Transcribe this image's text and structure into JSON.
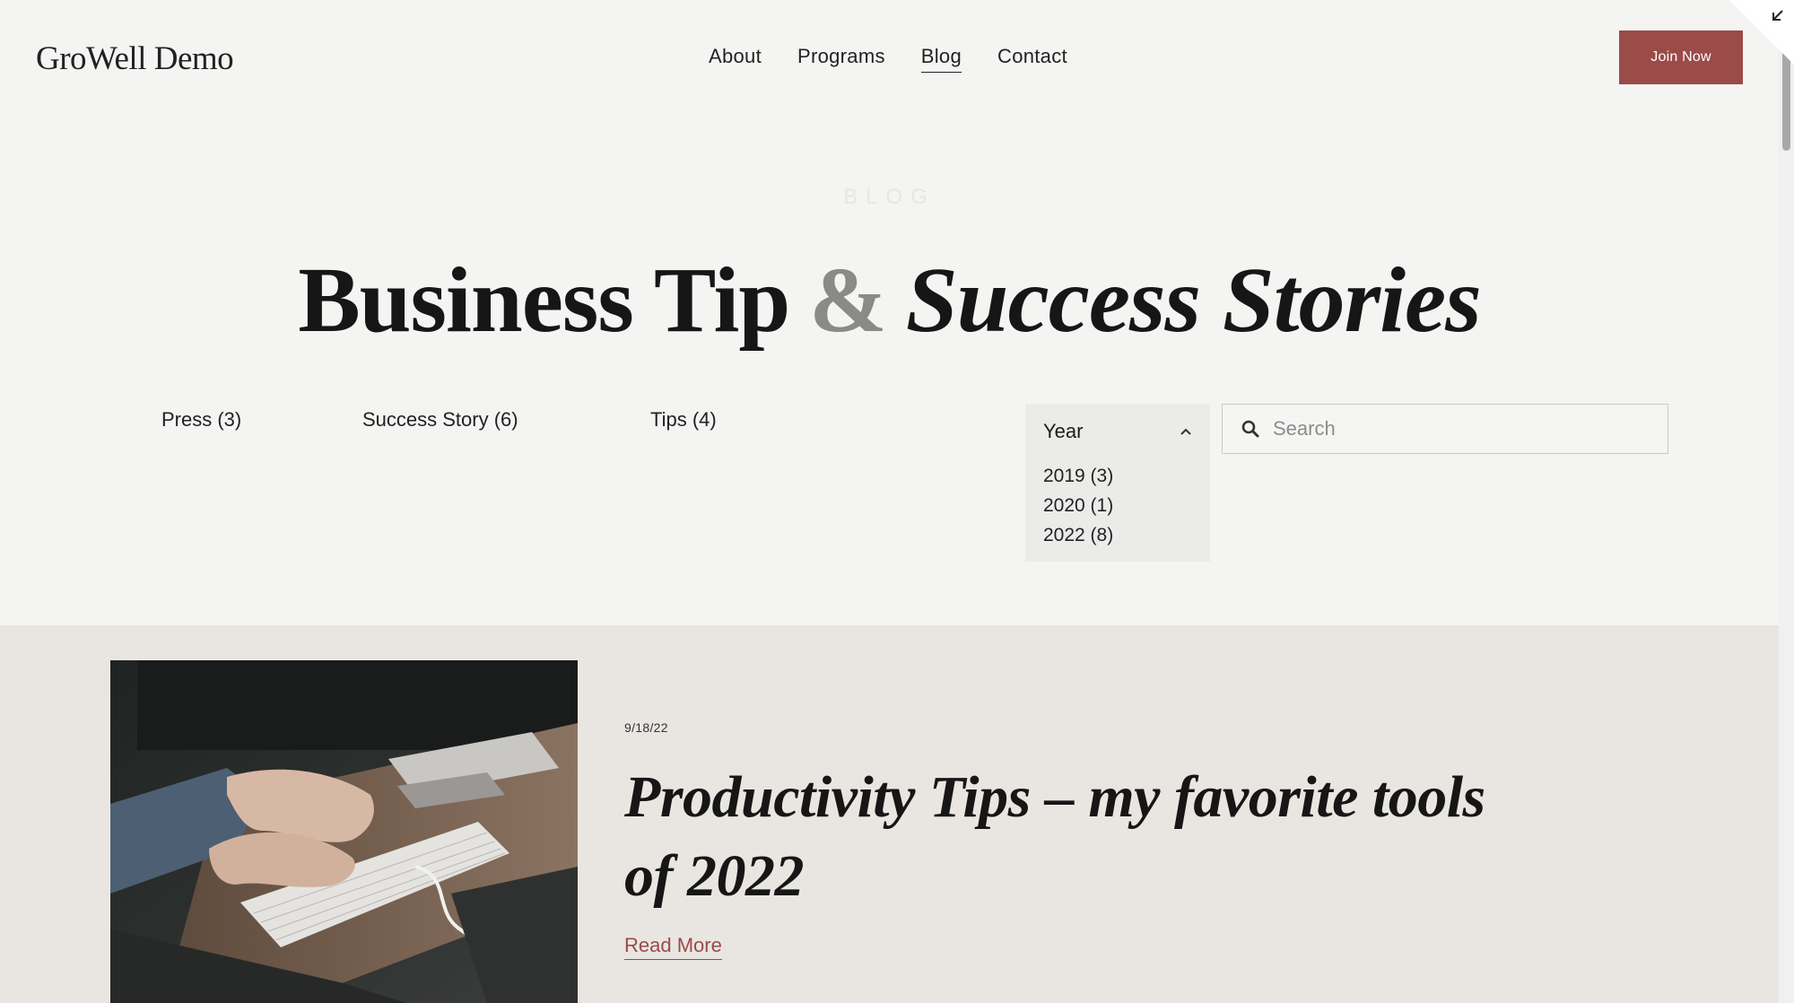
{
  "header": {
    "logo": "GroWell Demo",
    "nav": [
      "About",
      "Programs",
      "Blog",
      "Contact"
    ],
    "active_nav": "Blog",
    "cta_label": "Join Now"
  },
  "hero": {
    "eyebrow": "BLOG",
    "headline_part1": "Business Tip",
    "headline_amp": "&",
    "headline_part2": "Success Stories"
  },
  "filters": {
    "categories": [
      "Press (3)",
      "Success Story (6)",
      "Tips (4)"
    ],
    "year_label": "Year",
    "years": [
      "2019 (3)",
      "2020 (1)",
      "2022 (8)"
    ],
    "search_placeholder": "Search"
  },
  "post": {
    "date": "9/18/22",
    "title": "Productivity Tips – my favorite tools of 2022",
    "read_more": "Read More",
    "image_desc": "hands typing on keyboard"
  },
  "colors": {
    "accent": "#9b4b48",
    "background": "#f4f4f3",
    "section_bg": "#e9e6e2"
  }
}
